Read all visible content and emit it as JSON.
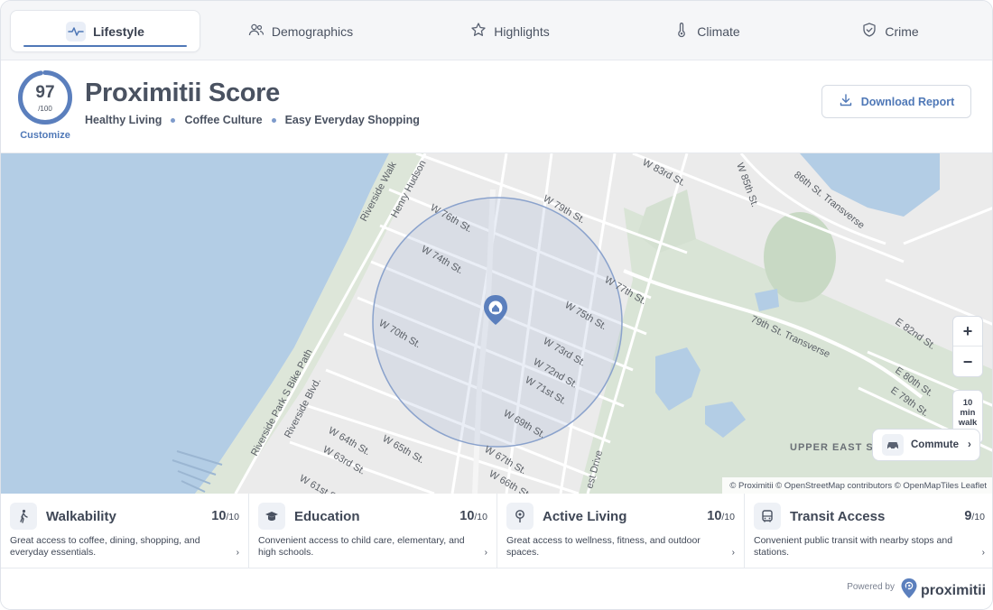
{
  "tabs": [
    {
      "label": "Lifestyle",
      "icon": "pulse-icon",
      "active": true
    },
    {
      "label": "Demographics",
      "icon": "people-icon"
    },
    {
      "label": "Highlights",
      "icon": "star-icon"
    },
    {
      "label": "Climate",
      "icon": "thermometer-icon"
    },
    {
      "label": "Crime",
      "icon": "shield-icon"
    }
  ],
  "score": {
    "value": "97",
    "denominator": "/100",
    "fraction": 0.97,
    "customize_label": "Customize"
  },
  "header": {
    "title": "Proximitii Score",
    "tags": [
      "Healthy Living",
      "Coffee Culture",
      "Easy Everyday Shopping"
    ],
    "download_label": "Download Report"
  },
  "map": {
    "street_labels": {
      "w83": "W 83rd St.",
      "w85": "W 85th St.",
      "t86": "86th St. Transverse",
      "w79": "W 79th St.",
      "w76": "W 76th St.",
      "w74": "W 74th St.",
      "w77": "W 77th St.",
      "w75": "W 75th St.",
      "w73": "W 73rd St.",
      "w72": "W 72nd St.",
      "w71": "W 71st St.",
      "w70": "W 70th St.",
      "w69": "W 69th St.",
      "w67": "W 67th St.",
      "w66": "W 66th St.",
      "w65": "W 65th St.",
      "w64": "W 64th St.",
      "w63": "W 63rd St.",
      "w61": "W 61st S",
      "riverside_walk": "Riverside Walk",
      "henry_hudson": "Henry Hudson",
      "riverside_park": "Riverside Park S Bike Path",
      "riverside_blvd": "Riverside Blvd.",
      "t79": "79th St. Transverse",
      "e82": "E 82nd St.",
      "e80": "E 80th St.",
      "e79": "E 79th St.",
      "upper_east": "UPPER EAST S",
      "west_drive": "est Drive"
    },
    "zoom_in": "+",
    "zoom_out": "−",
    "walk_lines": [
      "10",
      "min",
      "walk"
    ],
    "commute_label": "Commute",
    "attribution": "© Proximitii © OpenStreetMap contributors © OpenMapTiles Leaflet",
    "colors": {
      "water": "#b3cde5",
      "park": "#d9e4d6",
      "land": "#ebebeb",
      "radius": "#8aa2cc",
      "pin": "#5b7fbd"
    }
  },
  "cards": [
    {
      "title": "Walkability",
      "score": "10",
      "max": "/10",
      "icon": "walking-person-icon",
      "description": "Great access to coffee, dining, shopping, and everyday essentials."
    },
    {
      "title": "Education",
      "score": "10",
      "max": "/10",
      "icon": "graduation-cap-icon",
      "description": "Convenient access to child care, elementary, and high schools."
    },
    {
      "title": "Active Living",
      "score": "10",
      "max": "/10",
      "icon": "location-pin-icon",
      "description": "Great access to wellness, fitness, and outdoor spaces."
    },
    {
      "title": "Transit Access",
      "score": "9",
      "max": "/10",
      "icon": "bus-icon",
      "description": "Convenient public transit with nearby stops and stations."
    }
  ],
  "footer": {
    "powered_by": "Powered by",
    "brand": "proximitii"
  },
  "arrow": "›"
}
